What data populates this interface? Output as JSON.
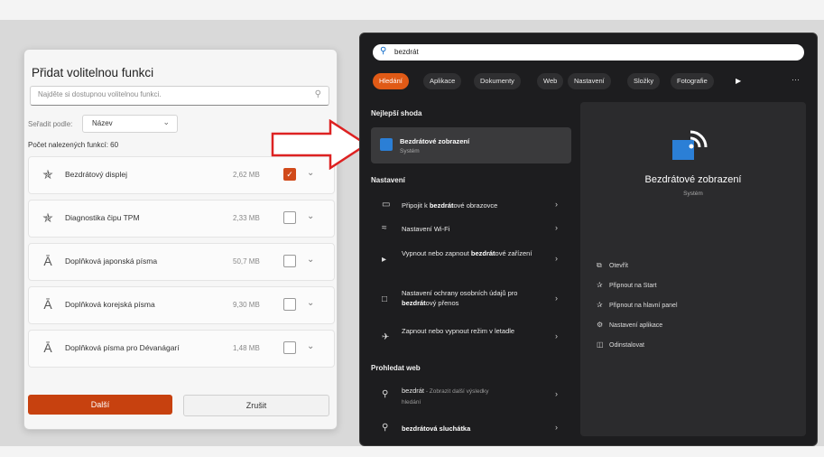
{
  "dialog": {
    "title": "Přidat volitelnou funkci",
    "search_placeholder": "Najděte si dostupnou volitelnou funkci.",
    "sort_label": "Seřadit podle:",
    "sort_value": "Název",
    "count": "Počet nalezených funkcí: 60",
    "features": [
      {
        "name": "Bezdrátový displej",
        "size": "2,62 MB",
        "checked": true,
        "icon": "gear-icon"
      },
      {
        "name": "Diagnostika čipu TPM",
        "size": "2,33 MB",
        "checked": false,
        "icon": "gear-icon"
      },
      {
        "name": "Doplňková japonská písma",
        "size": "50,7 MB",
        "checked": false,
        "icon": "font-icon"
      },
      {
        "name": "Doplňková korejská písma",
        "size": "9,30 MB",
        "checked": false,
        "icon": "font-icon"
      },
      {
        "name": "Doplňková písma pro Dévanágarí",
        "size": "1,48 MB",
        "checked": false,
        "icon": "font-icon"
      }
    ],
    "next_label": "Další",
    "cancel_label": "Zrušit",
    "accent": "#c7410f"
  },
  "panel": {
    "query": "bezdrát",
    "filters": [
      "Hledání",
      "Aplikace",
      "Dokumenty",
      "Web",
      "Nastavení",
      "Složky",
      "Fotografie"
    ],
    "best_match_header": "Nejlepší shoda",
    "best_match": {
      "title": "Bezdrátové zobrazení",
      "subtitle": "Systém"
    },
    "settings_header": "Nastavení",
    "settings_results": [
      {
        "pre": "Připojit k ",
        "bold": "bezdrát",
        "post": "ové obrazovce"
      },
      {
        "pre": "Nastavení Wi-Fi",
        "bold": "",
        "post": ""
      },
      {
        "pre": "Vypnout nebo zapnout ",
        "bold": "bezdrát",
        "post": "ové zařízení"
      },
      {
        "pre": "Nastavení ochrany osobních údajů pro ",
        "bold": "bezdrát",
        "post": "ový přenos"
      },
      {
        "pre": "Zapnout nebo vypnout režim v letadle",
        "bold": "",
        "post": ""
      }
    ],
    "web_header": "Prohledat web",
    "web_results": [
      {
        "text": "bezdrát",
        "extra": " - Zobrazit další výsledky",
        "sub": "hledání"
      },
      {
        "text": "bezdrátová sluchátka",
        "extra": "",
        "sub": ""
      }
    ],
    "detail": {
      "name": "Bezdrátové zobrazení",
      "type": "Systém",
      "actions": [
        "Otevřít",
        "Připnout na Start",
        "Připnout na hlavní panel",
        "Nastavení aplikace",
        "Odinstalovat"
      ]
    },
    "accent": "#e05a16"
  }
}
